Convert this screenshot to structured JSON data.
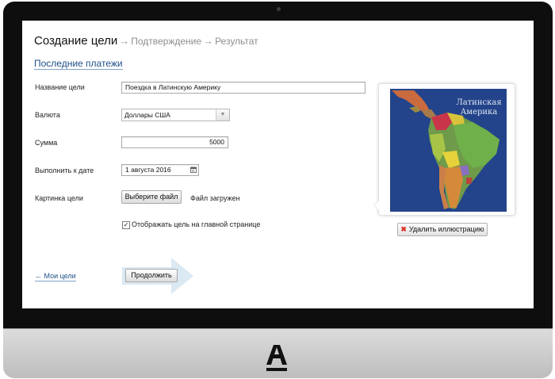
{
  "breadcrumb": {
    "step_current": "Создание цели",
    "arrow": "→",
    "step_confirm": "Подтверждение",
    "step_result": "Результат"
  },
  "recent_payments_link": "Последние платежи",
  "form": {
    "goal_name_label": "Название цели",
    "goal_name_value": "Поездка в Латинскую Америку",
    "currency_label": "Валюта",
    "currency_value": "Доллары США",
    "amount_label": "Сумма",
    "amount_value": "5000",
    "date_label": "Выполнить к дате",
    "date_value": "1 августа 2016",
    "picture_label": "Картинка цели",
    "choose_file_button": "Выберите файл",
    "file_status": "Файл загружен",
    "show_on_main_checked": true,
    "show_on_main_label": "Отображать цель на главной странице",
    "continue_button": "Продолжить",
    "back_link": "← Мои цели"
  },
  "preview": {
    "map_caption_line1": "Латинская",
    "map_caption_line2": "Америка",
    "delete_button": "Удалить иллюстрацию"
  },
  "icons": {
    "delete": "x-icon",
    "calendar": "calendar-icon",
    "select": "chevron-down-icon",
    "checkbox": "checkmark-icon",
    "brand": "alfa-bank-logo"
  },
  "colors": {
    "link": "#1d4f88",
    "delete_x": "#d8332c",
    "map_ocean": "#1f3e83"
  }
}
